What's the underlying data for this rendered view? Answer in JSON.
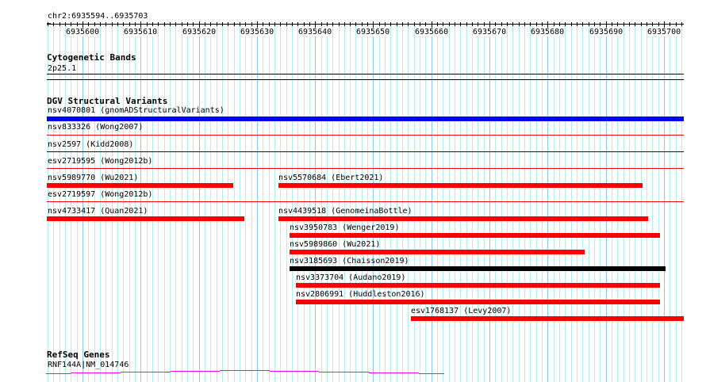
{
  "ruler": {
    "location": "chr2:6935594..6935703",
    "start": 6935594,
    "end": 6935703,
    "tick_labels": [
      "6935600",
      "6935610",
      "6935620",
      "6935630",
      "6935640",
      "6935650",
      "6935660",
      "6935670",
      "6935680",
      "6935690",
      "6935700"
    ]
  },
  "cytobands": {
    "title": "Cytogenetic Bands",
    "band": "2p25.1"
  },
  "dgv": {
    "title": "DGV Structural Variants",
    "features": [
      {
        "label": "nsv4070801 (gnomADStructuralVariants)",
        "start": 6935594,
        "end": 6935703,
        "color": "#0000ff"
      },
      {
        "label": "nsv833326 (Wong2007)"
      },
      {
        "label": "nsv2597 (Kidd2008)"
      },
      {
        "label": "esv2719595 (Wong2012b)"
      },
      {
        "label": "nsv5989770 (Wu2021)",
        "start": 6935594,
        "end": 6935626,
        "color": "#ff0000"
      },
      {
        "label": "nsv5570684 (Ebert2021)",
        "start": 6935634,
        "end": 6935697,
        "color": "#ff0000"
      },
      {
        "label": "esv2719597 (Wong2012b)"
      },
      {
        "label": "nsv4733417 (Quan2021)",
        "start": 6935594,
        "end": 6935628,
        "color": "#ff0000"
      },
      {
        "label": "nsv4439518 (GenomeinaBottle)",
        "start": 6935634,
        "end": 6935698,
        "color": "#ff0000"
      },
      {
        "label": "nsv3950783 (Wenger2019)",
        "start": 6935636,
        "end": 6935700,
        "color": "#ff0000"
      },
      {
        "label": "nsv5989860 (Wu2021)",
        "start": 6935636,
        "end": 6935687,
        "color": "#ff0000"
      },
      {
        "label": "nsv3185693 (Chaisson2019)",
        "start": 6935636,
        "end": 6935701,
        "color": "#000000"
      },
      {
        "label": "nsv3373704 (Audano2019)",
        "start": 6935637,
        "end": 6935700,
        "color": "#ff0000"
      },
      {
        "label": "nsv2806991 (Huddleston2016)",
        "start": 6935637,
        "end": 6935700,
        "color": "#ff0000"
      },
      {
        "label": "esv1768137 (Levy2007)",
        "start": 6935657,
        "end": 6935703,
        "color": "#ff0000"
      }
    ]
  },
  "refseq": {
    "title": "RefSeq Genes",
    "gene": "RNF144A|NM_014746",
    "color": "#ff00ff"
  }
}
